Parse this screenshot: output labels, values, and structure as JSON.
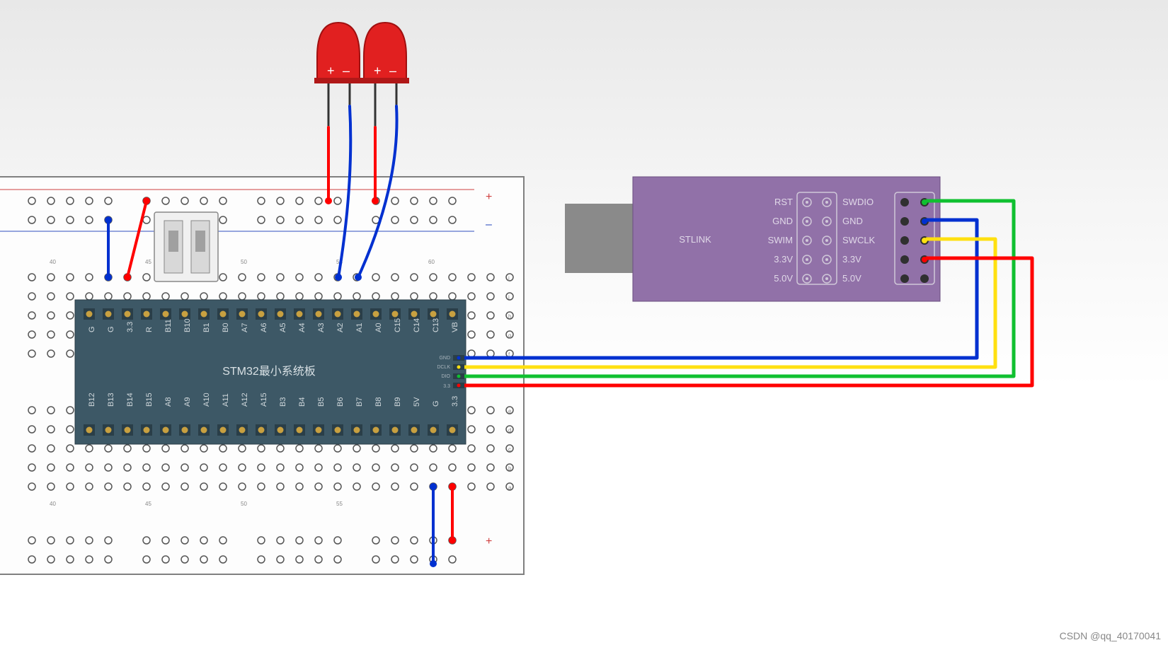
{
  "board": {
    "title": "STM32最小系统板",
    "top_pins": [
      "G",
      "G",
      "3.3",
      "R",
      "B11",
      "B10",
      "B1",
      "B0",
      "A7",
      "A6",
      "A5",
      "A4",
      "A3",
      "A2",
      "A1",
      "A0",
      "C15",
      "C14",
      "C13",
      "VB"
    ],
    "bottom_pins": [
      "B12",
      "B13",
      "B14",
      "B15",
      "A8",
      "A9",
      "A10",
      "A11",
      "A12",
      "A15",
      "B3",
      "B4",
      "B5",
      "B6",
      "B7",
      "B8",
      "B9",
      "5V",
      "G",
      "3.3"
    ],
    "side_labels": [
      "GND",
      "DCLK",
      "DIO",
      "3.3"
    ]
  },
  "stlink": {
    "title": "STLINK",
    "left_pins": [
      "RST",
      "GND",
      "SWIM",
      "3.3V",
      "5.0V"
    ],
    "right_pins": [
      "SWDIO",
      "GND",
      "SWCLK",
      "3.3V",
      "5.0V"
    ]
  },
  "breadboard": {
    "col_numbers_top": [
      "40",
      "45",
      "50",
      "55",
      "60"
    ],
    "col_numbers_bot": [
      "40",
      "45",
      "50",
      "55"
    ],
    "row_labels_top": [
      "j",
      "i",
      "h",
      "g"
    ],
    "row_labels_bot": [
      "e",
      "d"
    ],
    "rail_plus": "+",
    "rail_minus": "–"
  },
  "led": {
    "plus": "+",
    "minus": "–"
  },
  "watermark": "CSDN @qq_40170041",
  "colors": {
    "board_fill": "#3d5866",
    "stlink_fill": "#9171a8",
    "led_red": "#e12020",
    "wire_red": "#ff0000",
    "wire_blue": "#0030d0",
    "wire_green": "#10c030",
    "wire_yellow": "#ffe010",
    "breadboard_border": "#808080",
    "hole": "#333"
  }
}
